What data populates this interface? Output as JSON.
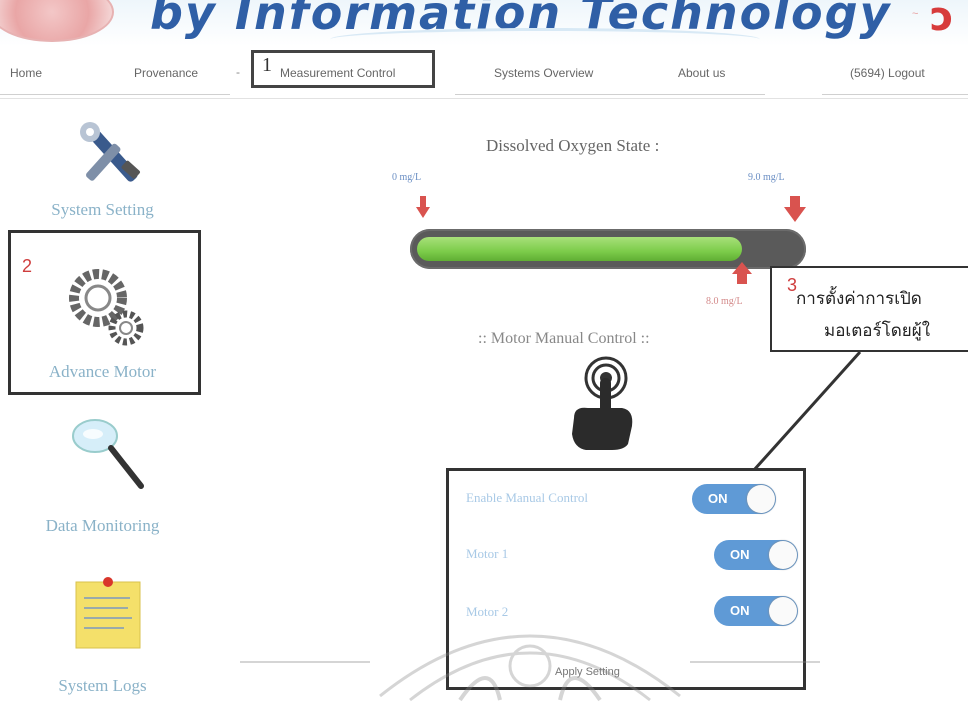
{
  "header": {
    "title": "by Information Technology"
  },
  "nav": {
    "items": [
      {
        "label": "Home"
      },
      {
        "label": "Provenance"
      },
      {
        "label": "Measurement Control"
      },
      {
        "label": "Systems Overview"
      },
      {
        "label": "About us"
      },
      {
        "label": "(5694) Logout"
      }
    ],
    "separator": "-",
    "marker_number": "1"
  },
  "sidebar": {
    "items": [
      {
        "label": "System Setting",
        "icon": "tools-icon"
      },
      {
        "label": "Advance Motor",
        "icon": "gears-icon"
      },
      {
        "label": "Data Monitoring",
        "icon": "magnifier-icon"
      },
      {
        "label": "System Logs",
        "icon": "sticky-note-icon"
      }
    ],
    "marker_number": "2"
  },
  "oxygen": {
    "title": "Dissolved Oxygen State :",
    "min_label": "0 mg/L",
    "max_label": "9.0 mg/L",
    "current_label": "8.0 mg/L",
    "fill_fraction": 0.85,
    "bar_color": "#7ccc4a",
    "marker_color": "#d9534f"
  },
  "motor": {
    "title": ":: Motor Manual Control ::",
    "icon": "touch-hand-icon"
  },
  "callout": {
    "marker_number": "3",
    "line1": "การตั้งค่าการเปิด",
    "line2": "มอเตอร์โดยผู้ใ"
  },
  "controls": {
    "items": [
      {
        "label": "Enable Manual Control",
        "state": "ON"
      },
      {
        "label": "Motor 1",
        "state": "ON"
      },
      {
        "label": "Motor 2",
        "state": "ON"
      }
    ],
    "apply_label": "Apply Setting",
    "toggle_color": "#5f9ad6"
  }
}
